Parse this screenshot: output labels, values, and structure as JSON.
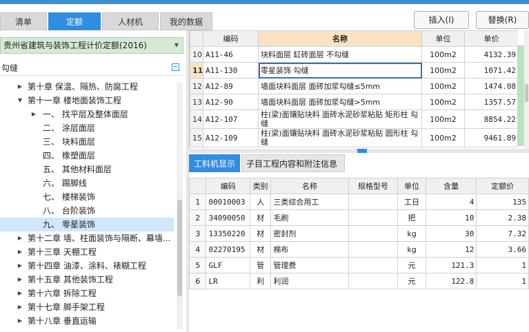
{
  "tabs": [
    "清单",
    "定额",
    "人材机",
    "我的数据"
  ],
  "active_tab": "定额",
  "toolbar": {
    "insert_label": "插入(I)",
    "replace_label": "替换(R)"
  },
  "quota_library": "贵州省建筑与装饰工程计价定额(2016)",
  "search": {
    "value": "勾缝"
  },
  "tree": [
    {
      "label": "第十章 保温、隔热、防腐工程",
      "indent": 0,
      "expander": true
    },
    {
      "label": "第十一章 楼地面装饰工程",
      "indent": 0,
      "expander": true,
      "expanded": true
    },
    {
      "label": "一、 找平层及整体面层",
      "indent": 1,
      "expander": true
    },
    {
      "label": "二、 涂层面层",
      "indent": 1,
      "expander": false
    },
    {
      "label": "三、 块料面层",
      "indent": 1,
      "expander": false
    },
    {
      "label": "四、 橡塑面层",
      "indent": 1,
      "expander": false
    },
    {
      "label": "五、 其他材料面层",
      "indent": 1,
      "expander": false
    },
    {
      "label": "六、 踢脚线",
      "indent": 1,
      "expander": false
    },
    {
      "label": "七、 楼梯装饰",
      "indent": 1,
      "expander": false
    },
    {
      "label": "八、 台阶装饰",
      "indent": 1,
      "expander": false
    },
    {
      "label": "九、 零星装饰",
      "indent": 1,
      "expander": false,
      "selected": true
    },
    {
      "label": "第十二章 墙、柱面装饰与隔断、幕墙...",
      "indent": 0,
      "expander": true
    },
    {
      "label": "第十三章 天棚工程",
      "indent": 0,
      "expander": true
    },
    {
      "label": "第十四章 油漆、涂料、裱糊工程",
      "indent": 0,
      "expander": true
    },
    {
      "label": "第十五章 其他装饰工程",
      "indent": 0,
      "expander": true
    },
    {
      "label": "第十六章 拆除工程",
      "indent": 0,
      "expander": true
    },
    {
      "label": "第十七章 脚手架工程",
      "indent": 0,
      "expander": true
    },
    {
      "label": "第十八章 垂直运输",
      "indent": 0,
      "expander": true
    }
  ],
  "quota_grid": {
    "headers": [
      "",
      "编码",
      "名称",
      "单位",
      "单价"
    ],
    "rows": [
      {
        "rn": "10",
        "code": "A11-46",
        "name": "块料面层 缸砖面层 不勾缝",
        "unit": "100m2",
        "price": "4132.39"
      },
      {
        "rn": "11",
        "code": "A11-130",
        "name": "零星装饰 勾缝",
        "unit": "100m2",
        "price": "1071.42",
        "current": true
      },
      {
        "rn": "12",
        "code": "A12-89",
        "name": "墙面块料面层 面砖加浆勾缝≤5mm",
        "unit": "100m2",
        "price": "1474.08"
      },
      {
        "rn": "13",
        "code": "A12-90",
        "name": "墙面块料面层 面砖加浆勾缝>5mm",
        "unit": "100m2",
        "price": "1357.57"
      },
      {
        "rn": "14",
        "code": "A12-107",
        "name": "柱(梁)面镶贴块料 面砖水泥砂浆粘贴 矩形柱 勾缝",
        "unit": "100m2",
        "price": "8854.22"
      },
      {
        "rn": "15",
        "code": "A12-109",
        "name": "柱(梁)面镶贴块料 面砖水泥砂浆粘贴 圆形柱 勾缝",
        "unit": "100m2",
        "price": "9461.89"
      }
    ]
  },
  "bottom_tabs": [
    "工料机显示",
    "子目工程内容和附注信息"
  ],
  "resource_grid": {
    "headers": [
      "",
      "编码",
      "类别",
      "名称",
      "规格型号",
      "单位",
      "含量",
      "定额价"
    ],
    "rows": [
      {
        "rn": "1",
        "code": "00010003",
        "cat": "人",
        "name": "三类综合用工",
        "spec": "",
        "unit": "工日",
        "qty": "4",
        "price": "135"
      },
      {
        "rn": "2",
        "code": "34090050",
        "cat": "材",
        "name": "毛刷",
        "spec": "",
        "unit": "把",
        "qty": "10",
        "price": "2.38"
      },
      {
        "rn": "3",
        "code": "13350220",
        "cat": "材",
        "name": "密封剂",
        "spec": "",
        "unit": "kg",
        "qty": "30",
        "price": "7.32"
      },
      {
        "rn": "4",
        "code": "02270195",
        "cat": "材",
        "name": "棉布",
        "spec": "",
        "unit": "kg",
        "qty": "12",
        "price": "3.66"
      },
      {
        "rn": "5",
        "code": "GLF",
        "cat": "管",
        "name": "管理费",
        "spec": "",
        "unit": "元",
        "qty": "121.3",
        "price": "1"
      },
      {
        "rn": "6",
        "code": "LR",
        "cat": "利",
        "name": "利润",
        "spec": "",
        "unit": "元",
        "qty": "122.8",
        "price": "1"
      }
    ]
  }
}
